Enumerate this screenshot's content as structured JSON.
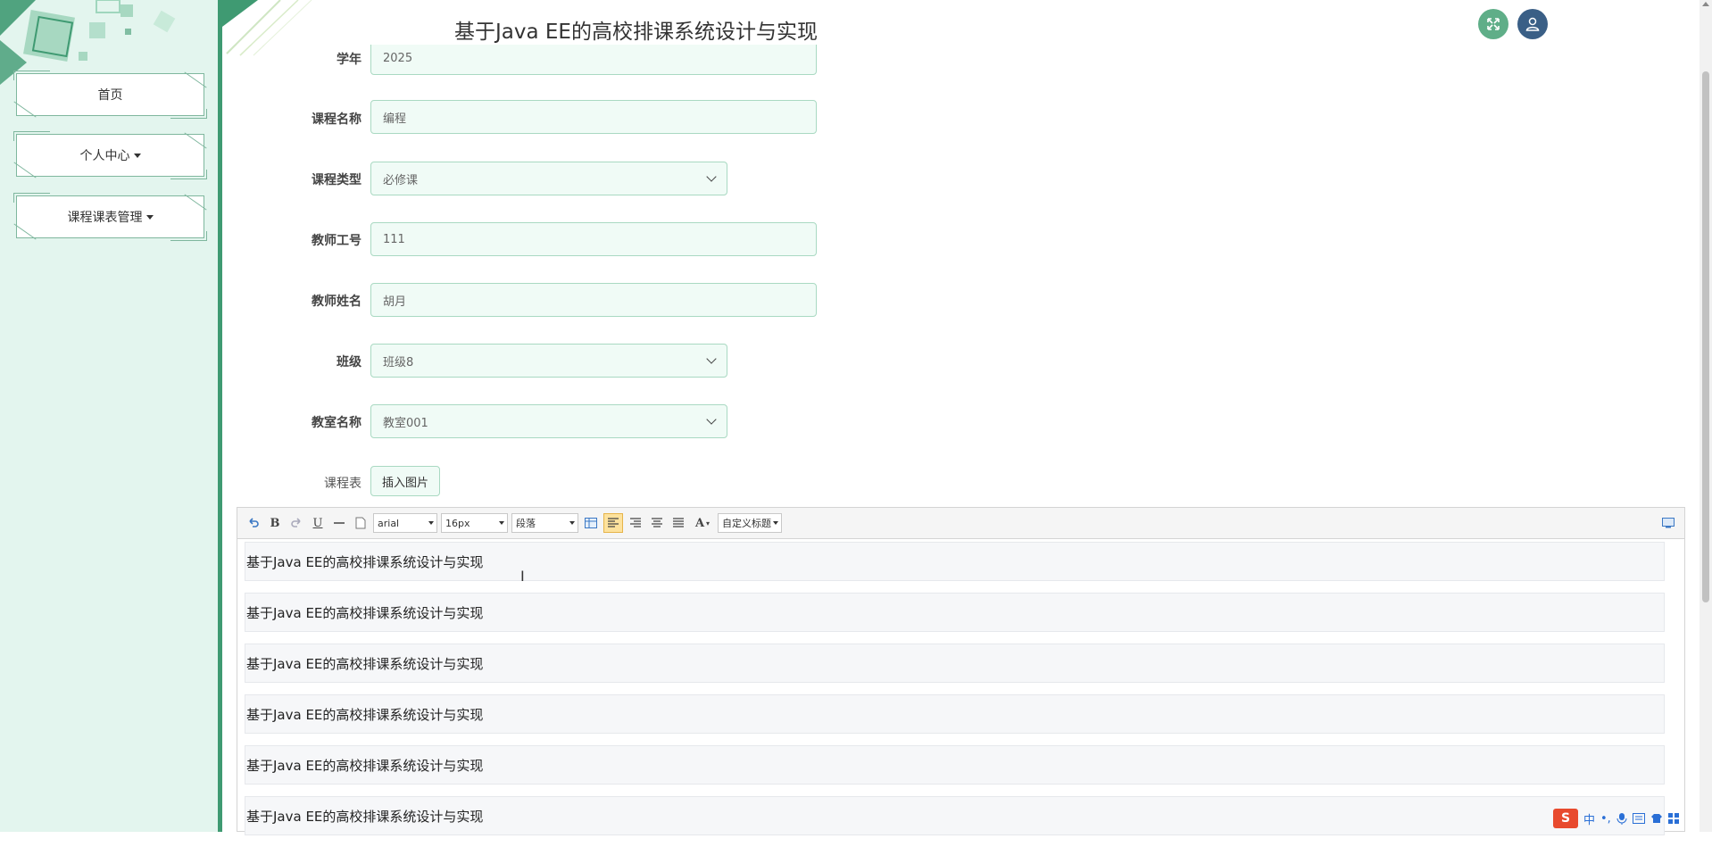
{
  "header": {
    "title": "基于Java EE的高校排课系统设计与实现"
  },
  "sidebar": {
    "items": [
      {
        "label": "首页"
      },
      {
        "label": "个人中心"
      },
      {
        "label": "课程课表管理"
      }
    ]
  },
  "form": {
    "year": {
      "label": "学年",
      "value": "2025"
    },
    "course_name": {
      "label": "课程名称",
      "value": "编程"
    },
    "course_type": {
      "label": "课程类型",
      "value": "必修课"
    },
    "teacher_id": {
      "label": "教师工号",
      "value": "111"
    },
    "teacher_name": {
      "label": "教师姓名",
      "value": "胡月"
    },
    "class": {
      "label": "班级",
      "value": "班级8"
    },
    "classroom": {
      "label": "教室名称",
      "value": "教室001"
    },
    "schedule": {
      "label": "课程表",
      "upload_label": "插入图片"
    }
  },
  "editor": {
    "font_family": "arial",
    "font_size": "16px",
    "paragraph": "段落",
    "custom_title": "自定义标题",
    "paragraphs": [
      "基于Java EE的高校排课系统设计与实现",
      "基于Java EE的高校排课系统设计与实现",
      "基于Java EE的高校排课系统设计与实现",
      "基于Java EE的高校排课系统设计与实现",
      "基于Java EE的高校排课系统设计与实现",
      "基于Java EE的高校排课系统设计与实现"
    ]
  },
  "ime": {
    "mode": "中",
    "punct": "•,"
  },
  "colors": {
    "accent": "#3f9a72",
    "sidebar_bg": "#e3f5ee",
    "input_bg": "#f0fbf6",
    "user_btn": "#3a5f86"
  }
}
